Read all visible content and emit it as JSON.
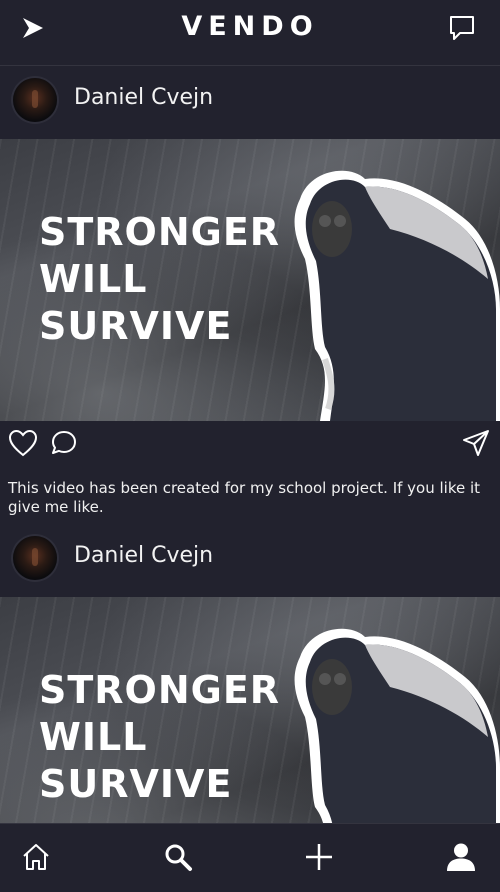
{
  "app": {
    "logo": "VENDO"
  },
  "posts": [
    {
      "author": "Daniel Cvejn",
      "media_headline": [
        "STRONGER",
        "WILL",
        "SURVIVE"
      ],
      "caption": "This video has been created for my school project. If you like it give me like."
    },
    {
      "author": "Daniel Cvejn",
      "media_headline": [
        "STRONGER",
        "WILL",
        "SURVIVE"
      ]
    }
  ],
  "icons": {
    "topbar": [
      "back-arrow-icon",
      "chat-icon"
    ],
    "post_actions": [
      "heart-icon",
      "comment-icon",
      "send-icon"
    ],
    "bottom_nav": [
      "home-icon",
      "search-icon",
      "plus-icon",
      "user-icon"
    ]
  },
  "colors": {
    "background": "#22222e",
    "text": "#ffffff",
    "divider": "#34343f"
  }
}
